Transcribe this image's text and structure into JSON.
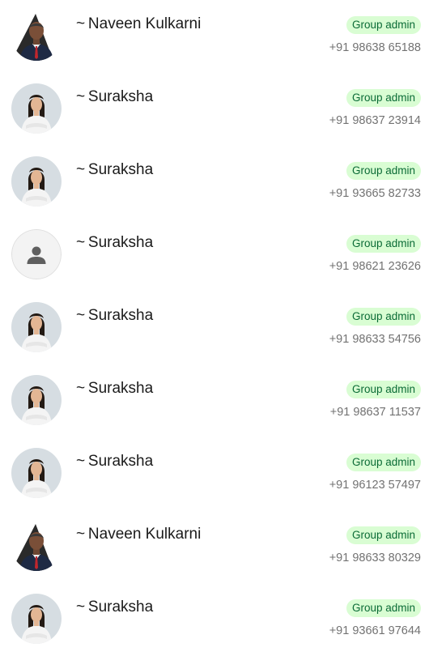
{
  "members": [
    {
      "name": "~ Naveen Kulkarni",
      "badge": "Group admin",
      "phone": "+91 98638 65188",
      "avatar": "man-photo"
    },
    {
      "name": "~ Suraksha",
      "badge": "Group admin",
      "phone": "+91 98637 23914",
      "avatar": "woman-photo"
    },
    {
      "name": "~ Suraksha",
      "badge": "Group admin",
      "phone": "+91 93665 82733",
      "avatar": "woman-photo"
    },
    {
      "name": "~ Suraksha",
      "badge": "Group admin",
      "phone": "+91 98621 23626",
      "avatar": "default-person"
    },
    {
      "name": "~ Suraksha",
      "badge": "Group admin",
      "phone": "+91 98633 54756",
      "avatar": "woman-photo"
    },
    {
      "name": "~ Suraksha",
      "badge": "Group admin",
      "phone": "+91 98637 11537",
      "avatar": "woman-photo"
    },
    {
      "name": "~ Suraksha",
      "badge": "Group admin",
      "phone": "+91 96123 57497",
      "avatar": "woman-photo"
    },
    {
      "name": "~ Naveen Kulkarni",
      "badge": "Group admin",
      "phone": "+91 98633 80329",
      "avatar": "man-photo"
    },
    {
      "name": "~ Suraksha",
      "badge": "Group admin",
      "phone": "+91 93661 97644",
      "avatar": "woman-photo"
    }
  ],
  "colors": {
    "badge_bg": "#d9fdd3",
    "badge_text": "#0b6b36",
    "name_text": "#1b1b1b",
    "phone_text": "#727272"
  }
}
